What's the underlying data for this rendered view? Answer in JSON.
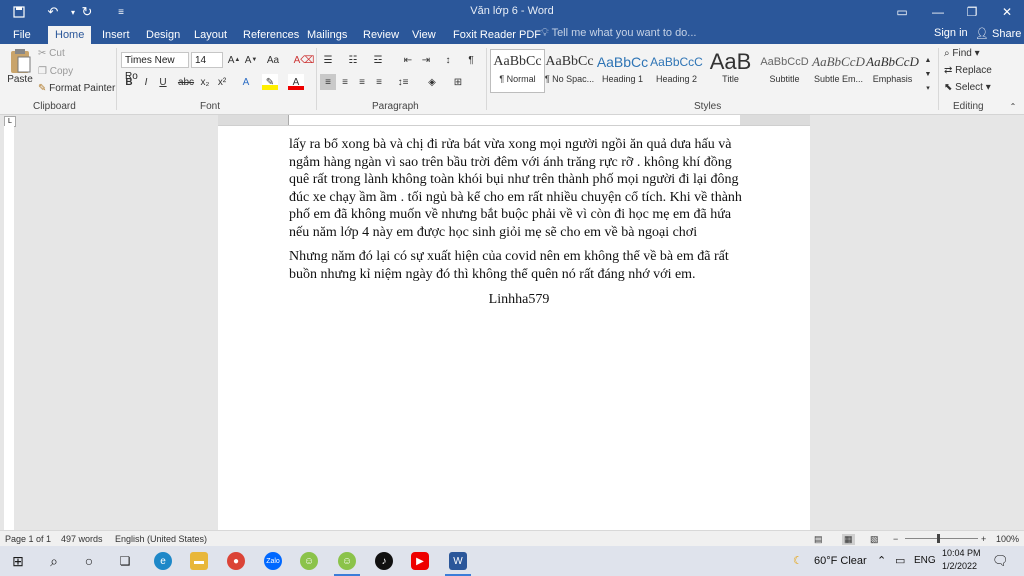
{
  "window": {
    "title": "Văn lớp 6 - Word"
  },
  "tabs": [
    "File",
    "Home",
    "Insert",
    "Design",
    "Layout",
    "References",
    "Mailings",
    "Review",
    "View",
    "Foxit Reader PDF"
  ],
  "tell_me": "Tell me what you want to do...",
  "account": {
    "sign_in": "Sign in",
    "share": "Share"
  },
  "clipboard": {
    "paste": "Paste",
    "cut": "Cut",
    "copy": "Copy",
    "format_painter": "Format Painter",
    "label": "Clipboard"
  },
  "font": {
    "name": "Times New Ro",
    "size": "14",
    "label": "Font"
  },
  "paragraph": {
    "label": "Paragraph"
  },
  "styles": {
    "label": "Styles",
    "items": [
      {
        "preview": "AaBbCc",
        "name": "¶ Normal"
      },
      {
        "preview": "AaBbCc",
        "name": "¶ No Spac..."
      },
      {
        "preview": "AaBbCc",
        "name": "Heading 1"
      },
      {
        "preview": "AaBbCcC",
        "name": "Heading 2"
      },
      {
        "preview": "AaB",
        "name": "Title"
      },
      {
        "preview": "AaBbCcD",
        "name": "Subtitle"
      },
      {
        "preview": "AaBbCcD",
        "name": "Subtle Em..."
      },
      {
        "preview": "AaBbCcD",
        "name": "Emphasis"
      }
    ]
  },
  "editing": {
    "find": "Find",
    "replace": "Replace",
    "select": "Select",
    "label": "Editing"
  },
  "document": {
    "p1": "lấy ra bổ xong bà và chị đi rửa bát vừa xong mọi người ngồi ăn quả dưa hấu và ngắm hàng ngàn vì sao trên bầu trời đêm với ánh trăng rực rỡ . không khí đồng quê rất trong lành không toàn khói bụi như trên thành phố mọi người đi lại đông đúc xe chạy ầm ầm . tối ngủ bà kể cho em rất nhiều chuyện cổ tích. Khi về thành phố em đã không muốn về nhưng bắt buộc phải về vì còn đi học mẹ em đã hứa nếu năm lớp 4 này em được học sinh giỏi mẹ sẽ cho em về bà ngoại chơi",
    "p2": "Nhưng năm đó lại có sự xuất hiện của covid nên em không thể về bà em đã rất buồn nhưng kỉ niệm ngày đó thì không thể quên nó rất đáng nhớ với em.",
    "signature": "Linhha579"
  },
  "status": {
    "page": "Page 1 of 1",
    "words": "497 words",
    "language": "English (United States)",
    "zoom": "100%"
  },
  "taskbar": {
    "weather": "60°F  Clear",
    "lang": "ENG",
    "time": "10:04 PM",
    "date": "1/2/2022"
  },
  "colors": {
    "accent": "#2b579a"
  }
}
